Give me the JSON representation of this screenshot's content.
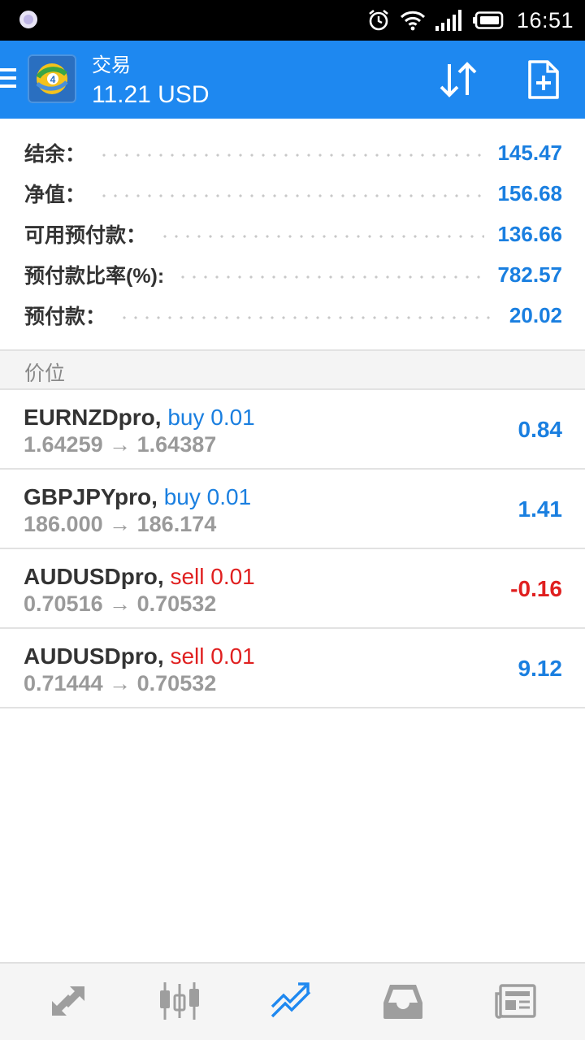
{
  "status_bar": {
    "time": "16:51",
    "icons": [
      "alarm-icon",
      "wifi-icon",
      "signal-icon",
      "battery-icon"
    ]
  },
  "app_bar": {
    "title": "交易",
    "subtitle": "11.21 USD",
    "accent_color": "#1e88f0",
    "actions": [
      "sort-icon",
      "new-order-icon"
    ]
  },
  "summary": [
    {
      "label": "结余：",
      "value": "145.47"
    },
    {
      "label": "净值：",
      "value": "156.68"
    },
    {
      "label": "可用预付款：",
      "value": "136.66"
    },
    {
      "label": "预付款比率(%):",
      "value": "782.57"
    },
    {
      "label": "预付款：",
      "value": "20.02"
    }
  ],
  "section_title": "价位",
  "positions": [
    {
      "symbol": "EURNZDpro,",
      "action": "buy 0.01",
      "side": "buy",
      "open": "1.64259",
      "arrow": "→",
      "current": "1.64387",
      "profit": "0.84"
    },
    {
      "symbol": "GBPJPYpro,",
      "action": "buy 0.01",
      "side": "buy",
      "open": "186.000",
      "arrow": "→",
      "current": "186.174",
      "profit": "1.41"
    },
    {
      "symbol": "AUDUSDpro,",
      "action": "sell 0.01",
      "side": "sell",
      "open": "0.70516",
      "arrow": "→",
      "current": "0.70532",
      "profit": "-0.16"
    },
    {
      "symbol": "AUDUSDpro,",
      "action": "sell 0.01",
      "side": "sell",
      "open": "0.71444",
      "arrow": "→",
      "current": "0.70532",
      "profit": "9.12"
    }
  ],
  "colors": {
    "positive": "#1a7fe0",
    "negative": "#e02020"
  },
  "bottom_nav": [
    {
      "icon": "quotes-icon",
      "active": false
    },
    {
      "icon": "chart-icon",
      "active": false
    },
    {
      "icon": "trade-icon",
      "active": true
    },
    {
      "icon": "history-icon",
      "active": false
    },
    {
      "icon": "news-icon",
      "active": false
    }
  ]
}
